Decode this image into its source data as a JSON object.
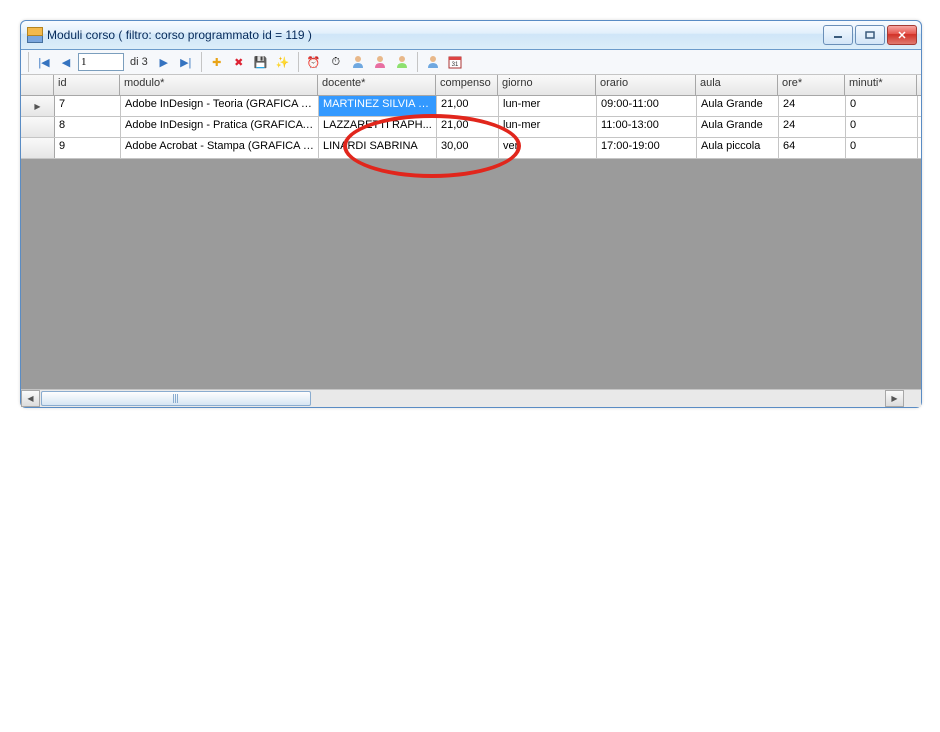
{
  "window": {
    "title": "Moduli corso ( filtro: corso programmato id = 119 )"
  },
  "nav": {
    "position": "1",
    "total_label": "di 3"
  },
  "table": {
    "headers": {
      "id": "id",
      "modulo": "modulo*",
      "docente": "docente*",
      "compenso": "compenso",
      "giorno": "giorno",
      "orario": "orario",
      "aula": "aula",
      "ore": "ore*",
      "minuti": "minuti*"
    },
    "rows": [
      {
        "active": true,
        "fields": {
          "id": "7",
          "modulo": "Adobe InDesign - Teoria (GRAFICA E...",
          "docente": "MARTINEZ SILVIA 2...",
          "compenso": "21,00",
          "giorno": "lun-mer",
          "orario": "09:00-11:00",
          "aula": "Aula Grande",
          "ore": "24",
          "minuti": "0"
        },
        "selected_col": "docente"
      },
      {
        "active": false,
        "fields": {
          "id": "8",
          "modulo": "Adobe InDesign - Pratica (GRAFICA E...",
          "docente": "LAZZARETTI RAPH...",
          "compenso": "21,00",
          "giorno": "lun-mer",
          "orario": "11:00-13:00",
          "aula": "Aula Grande",
          "ore": "24",
          "minuti": "0"
        }
      },
      {
        "active": false,
        "fields": {
          "id": "9",
          "modulo": "Adobe Acrobat - Stampa (GRAFICA E...",
          "docente": "LINARDI SABRINA",
          "compenso": "30,00",
          "giorno": "ven",
          "orario": "17:00-19:00",
          "aula": "Aula piccola",
          "ore": "64",
          "minuti": "0"
        }
      }
    ]
  },
  "icons": {
    "first": "|◀",
    "prev": "◀",
    "next": "▶",
    "last": "▶|",
    "add": "✚",
    "del": "✖",
    "save": "💾",
    "wand": "✨",
    "clock": "⏰",
    "timer": "⏱"
  }
}
